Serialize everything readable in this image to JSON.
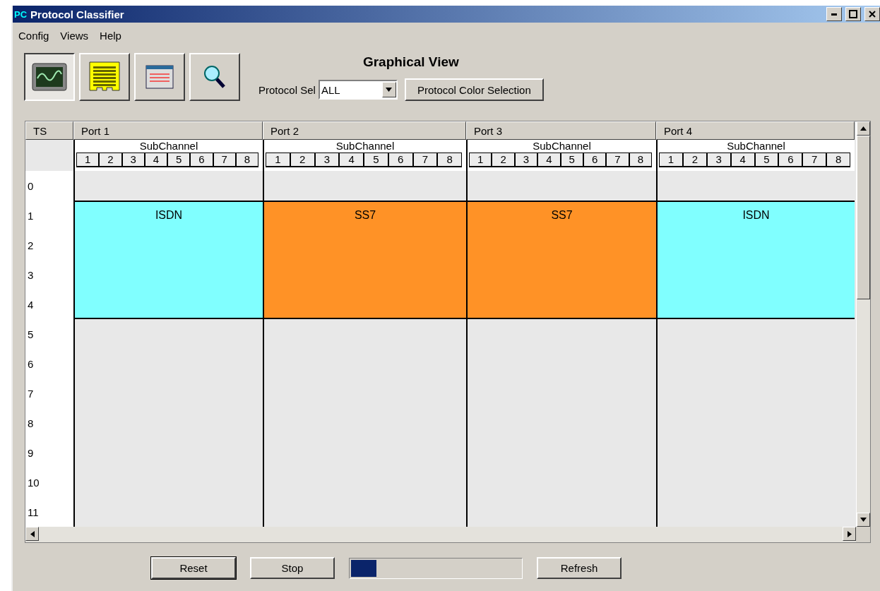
{
  "window": {
    "app_icon": "PC",
    "title": "Protocol Classifier"
  },
  "menu": [
    "Config",
    "Views",
    "Help"
  ],
  "toolbar": [
    {
      "kind": "scope",
      "selected": true
    },
    {
      "kind": "list",
      "selected": false
    },
    {
      "kind": "window",
      "selected": false
    },
    {
      "kind": "search",
      "selected": false
    }
  ],
  "view_title": "Graphical View",
  "protocol_sel": {
    "label": "Protocol Sel",
    "value": "ALL"
  },
  "color_button": "Protocol Color Selection",
  "grid": {
    "ts_header": "TS",
    "timeslots": [
      "0",
      "1",
      "2",
      "3",
      "4",
      "5",
      "6",
      "7",
      "8",
      "9",
      "10",
      "11"
    ],
    "ports": [
      {
        "name": "Port 1",
        "sub_title": "SubChannel",
        "subchannels": [
          "1",
          "2",
          "3",
          "4",
          "5",
          "6",
          "7",
          "8"
        ],
        "slots": [
          {
            "kind": "empty"
          },
          {
            "kind": "used",
            "label": "ISDN",
            "color": "#80ffff"
          },
          {
            "kind": "used",
            "color": "#80ffff"
          },
          {
            "kind": "used",
            "color": "#80ffff"
          },
          {
            "kind": "used",
            "color": "#80ffff"
          },
          {
            "kind": "empty"
          },
          {
            "kind": "empty"
          },
          {
            "kind": "empty"
          },
          {
            "kind": "empty"
          },
          {
            "kind": "empty"
          },
          {
            "kind": "empty"
          },
          {
            "kind": "empty"
          }
        ]
      },
      {
        "name": "Port 2",
        "sub_title": "SubChannel",
        "subchannels": [
          "1",
          "2",
          "3",
          "4",
          "5",
          "6",
          "7",
          "8"
        ],
        "slots": [
          {
            "kind": "empty"
          },
          {
            "kind": "used",
            "label": "SS7",
            "color": "#ff9226"
          },
          {
            "kind": "used",
            "color": "#ff9226"
          },
          {
            "kind": "used",
            "color": "#ff9226"
          },
          {
            "kind": "used",
            "color": "#ff9226"
          },
          {
            "kind": "empty"
          },
          {
            "kind": "empty"
          },
          {
            "kind": "empty"
          },
          {
            "kind": "empty"
          },
          {
            "kind": "empty"
          },
          {
            "kind": "empty"
          },
          {
            "kind": "empty"
          }
        ]
      },
      {
        "name": "Port 3",
        "sub_title": "SubChannel",
        "subchannels": [
          "1",
          "2",
          "3",
          "4",
          "5",
          "6",
          "7",
          "8"
        ],
        "slots": [
          {
            "kind": "empty"
          },
          {
            "kind": "used",
            "label": "SS7",
            "color": "#ff9226"
          },
          {
            "kind": "used",
            "color": "#ff9226"
          },
          {
            "kind": "used",
            "color": "#ff9226"
          },
          {
            "kind": "used",
            "color": "#ff9226"
          },
          {
            "kind": "empty"
          },
          {
            "kind": "empty"
          },
          {
            "kind": "empty"
          },
          {
            "kind": "empty"
          },
          {
            "kind": "empty"
          },
          {
            "kind": "empty"
          },
          {
            "kind": "empty"
          }
        ]
      },
      {
        "name": "Port 4",
        "sub_title": "SubChannel",
        "subchannels": [
          "1",
          "2",
          "3",
          "4",
          "5",
          "6",
          "7",
          "8"
        ],
        "slots": [
          {
            "kind": "empty"
          },
          {
            "kind": "used",
            "label": "ISDN",
            "color": "#80ffff"
          },
          {
            "kind": "used",
            "color": "#80ffff"
          },
          {
            "kind": "used",
            "color": "#80ffff"
          },
          {
            "kind": "used",
            "color": "#80ffff"
          },
          {
            "kind": "empty"
          },
          {
            "kind": "empty"
          },
          {
            "kind": "empty"
          },
          {
            "kind": "empty"
          },
          {
            "kind": "empty"
          },
          {
            "kind": "empty"
          },
          {
            "kind": "empty"
          }
        ]
      }
    ]
  },
  "buttons": {
    "reset": "Reset",
    "stop": "Stop",
    "refresh": "Refresh"
  },
  "progress": {
    "level": 0.15
  }
}
